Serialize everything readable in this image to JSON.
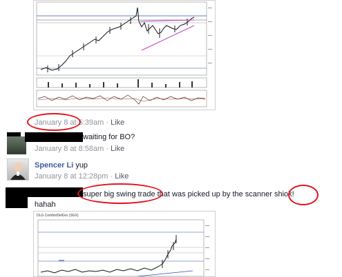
{
  "comments": [
    {
      "meta_date": "January 8",
      "meta_at": " at 5:39am · ",
      "meta_like": "Like"
    },
    {
      "text": "waiting for BO?",
      "meta_date": "January 8 at 8:58am · ",
      "meta_like": "Like"
    },
    {
      "author": "Spencer Li",
      "text": "yup",
      "meta_date": "January 8 at 12:28pm · ",
      "meta_like": "Like"
    },
    {
      "text_part1": "super big swing trade",
      "text_part2": " that was picked up by the scanner ",
      "text_part3": "shiok!",
      "text_line2": "hahah"
    }
  ],
  "chart2": {
    "header": "DLG ComfortDelGro (SGX)"
  },
  "colors": {
    "link": "#3b5998",
    "annotation": "#e0141e",
    "trendline": "#c040c0"
  }
}
